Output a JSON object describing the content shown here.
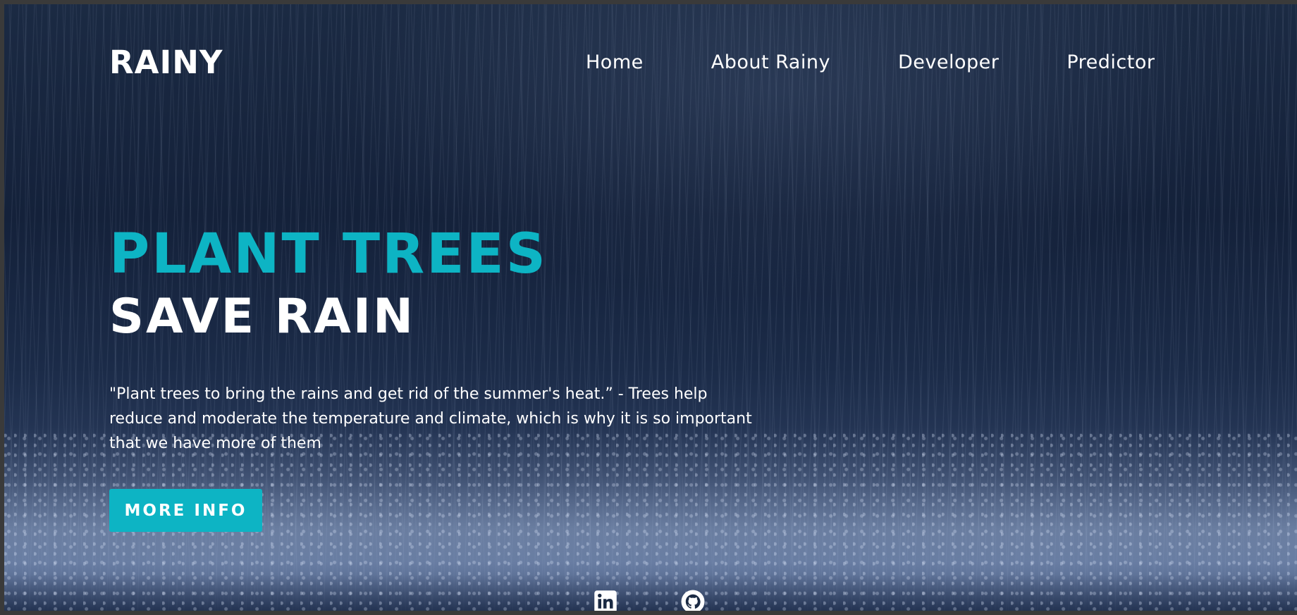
{
  "header": {
    "brand": "RAINY",
    "nav": [
      {
        "label": "Home"
      },
      {
        "label": "About Rainy"
      },
      {
        "label": "Developer"
      },
      {
        "label": "Predictor"
      }
    ]
  },
  "hero": {
    "title_line1": "PLANT TREES",
    "title_line2": "SAVE RAIN",
    "quote": "\"Plant trees to bring the rains and get rid of the summer's heat.” - Trees help reduce and moderate the temperature and climate, which is why it is so important that we have more of them",
    "button_label": "MORE INFO"
  },
  "social": [
    {
      "icon": "linkedin-icon"
    },
    {
      "icon": "github-icon"
    }
  ],
  "colors": {
    "accent": "#0db4c4",
    "text": "#ffffff",
    "background": "#1b2a43"
  }
}
